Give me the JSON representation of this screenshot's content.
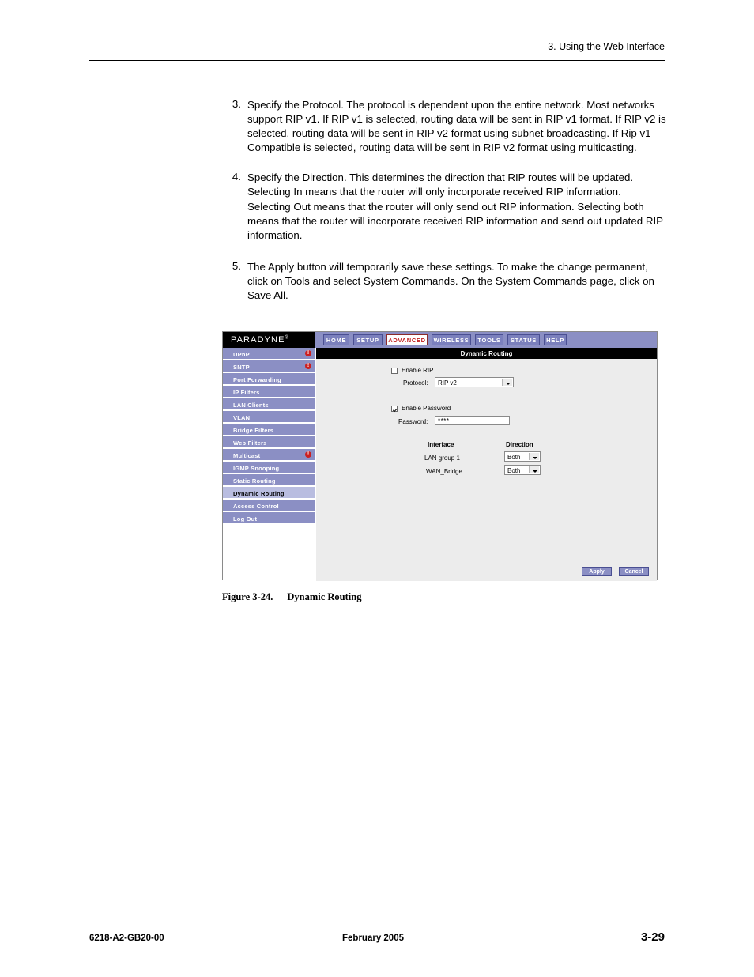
{
  "header": {
    "section_title": "3. Using the Web Interface"
  },
  "steps": [
    {
      "num": "3.",
      "text": "Specify the Protocol. The protocol is dependent upon the entire network. Most networks support RIP v1. If RIP v1 is selected, routing data will be sent in RIP v1 format. If RIP v2 is selected, routing data will be sent in RIP v2 format using subnet broadcasting. If Rip v1 Compatible is selected, routing data will be sent in RIP v2 format using multicasting."
    },
    {
      "num": "4.",
      "text": "Specify the Direction. This determines the direction that RIP routes will be updated. Selecting In means that the router will only incorporate received RIP information. Selecting Out means that the router will only send out RIP information. Selecting both means that the router will incorporate received RIP information and send out updated RIP information."
    },
    {
      "num": "5.",
      "text": "The Apply button will temporarily save these settings. To make the change permanent, click on Tools and select System Commands. On the System Commands page, click on Save All."
    }
  ],
  "figure": {
    "caption_number": "Figure 3-24.",
    "caption_text": "Dynamic Routing",
    "brand": "PARADYNE",
    "brand_tm": "®",
    "topnav": [
      {
        "label": "HOME",
        "active": false
      },
      {
        "label": "SETUP",
        "active": false
      },
      {
        "label": "ADVANCED",
        "active": true
      },
      {
        "label": "WIRELESS",
        "active": false
      },
      {
        "label": "TOOLS",
        "active": false
      },
      {
        "label": "STATUS",
        "active": false
      },
      {
        "label": "HELP",
        "active": false
      }
    ],
    "sidenav": [
      {
        "label": "UPnP",
        "selected": false,
        "warn": true
      },
      {
        "label": "SNTP",
        "selected": false,
        "warn": true
      },
      {
        "label": "Port Forwarding",
        "selected": false,
        "warn": false
      },
      {
        "label": "IP Filters",
        "selected": false,
        "warn": false
      },
      {
        "label": "LAN Clients",
        "selected": false,
        "warn": false
      },
      {
        "label": "VLAN",
        "selected": false,
        "warn": false
      },
      {
        "label": "Bridge Filters",
        "selected": false,
        "warn": false
      },
      {
        "label": "Web Filters",
        "selected": false,
        "warn": false
      },
      {
        "label": "Multicast",
        "selected": false,
        "warn": true
      },
      {
        "label": "IGMP Snooping",
        "selected": false,
        "warn": false
      },
      {
        "label": "Static Routing",
        "selected": false,
        "warn": false
      },
      {
        "label": "Dynamic Routing",
        "selected": true,
        "warn": false
      },
      {
        "label": "Access Control",
        "selected": false,
        "warn": false
      },
      {
        "label": "Log Out",
        "selected": false,
        "warn": false
      }
    ],
    "panel_title": "Dynamic Routing",
    "form": {
      "enable_rip_label": "Enable RIP",
      "enable_rip_checked": false,
      "protocol_label": "Protocol:",
      "protocol_value": "RIP v2",
      "enable_password_label": "Enable Password",
      "enable_password_checked": true,
      "password_label": "Password:",
      "password_value": "****",
      "table": {
        "headers": [
          "Interface",
          "Direction"
        ],
        "rows": [
          {
            "interface": "LAN group 1",
            "direction": "Both"
          },
          {
            "interface": "WAN_Bridge",
            "direction": "Both"
          }
        ]
      }
    },
    "buttons": {
      "apply": "Apply",
      "cancel": "Cancel"
    }
  },
  "footer": {
    "left": "6218-A2-GB20-00",
    "center": "February 2005",
    "right": "3-29"
  }
}
